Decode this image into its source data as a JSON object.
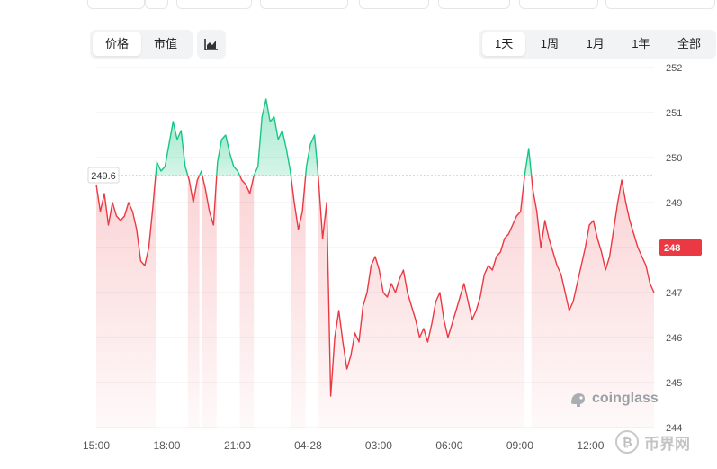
{
  "toolbar": {
    "metric_tabs": [
      {
        "label": "价格",
        "active": true
      },
      {
        "label": "市值",
        "active": false
      }
    ],
    "range_tabs": [
      {
        "label": "1天",
        "active": true
      },
      {
        "label": "1周",
        "active": false
      },
      {
        "label": "1月",
        "active": false
      },
      {
        "label": "1年",
        "active": false
      },
      {
        "label": "全部",
        "active": false
      }
    ],
    "chart_type_icon": "area-chart-icon"
  },
  "watermark": {
    "text": "coinglass",
    "icon": "coinglass-logo-icon"
  },
  "corner_logo": {
    "text": "币界网",
    "icon": "bitcoin-coin-icon"
  },
  "colors": {
    "up": "#16c784",
    "down": "#ea3943",
    "grid": "#ececec",
    "axis_text": "#555555"
  },
  "chart_data": {
    "type": "area",
    "baseline": 249.6,
    "baseline_label": "249.6",
    "last_value_label": "248",
    "x_ticks": [
      "15:00",
      "18:00",
      "21:00",
      "04-28",
      "03:00",
      "06:00",
      "09:00",
      "12:00"
    ],
    "y_ticks": [
      244,
      245,
      246,
      247,
      248,
      249,
      250,
      251,
      252
    ],
    "ylim": [
      244,
      252
    ],
    "xlim": [
      0,
      7.9
    ],
    "grid": true,
    "values": [
      249.4,
      248.8,
      249.2,
      248.5,
      249.0,
      248.7,
      248.6,
      248.7,
      249.0,
      248.8,
      248.4,
      247.7,
      247.6,
      248.0,
      248.9,
      249.9,
      249.7,
      249.8,
      250.3,
      250.8,
      250.4,
      250.6,
      249.8,
      249.5,
      249.0,
      249.5,
      249.7,
      249.3,
      248.8,
      248.5,
      249.9,
      250.4,
      250.5,
      250.1,
      249.8,
      249.7,
      249.5,
      249.4,
      249.2,
      249.6,
      249.8,
      250.9,
      251.3,
      250.8,
      250.9,
      250.4,
      250.6,
      250.2,
      249.7,
      249.0,
      248.4,
      248.8,
      249.8,
      250.3,
      250.5,
      249.5,
      248.2,
      249.0,
      244.7,
      246.0,
      246.6,
      245.9,
      245.3,
      245.6,
      246.1,
      245.9,
      246.7,
      247.0,
      247.6,
      247.8,
      247.5,
      247.0,
      246.9,
      247.2,
      247.0,
      247.3,
      247.5,
      247.0,
      246.7,
      246.4,
      246.0,
      246.2,
      245.9,
      246.3,
      246.8,
      247.0,
      246.4,
      246.0,
      246.3,
      246.6,
      246.9,
      247.2,
      246.8,
      246.4,
      246.6,
      246.9,
      247.4,
      247.6,
      247.5,
      247.8,
      247.9,
      248.2,
      248.3,
      248.5,
      248.7,
      248.8,
      249.6,
      250.2,
      249.3,
      248.8,
      248.0,
      248.6,
      248.2,
      247.9,
      247.6,
      247.4,
      247.0,
      246.6,
      246.8,
      247.2,
      247.6,
      248.0,
      248.5,
      248.6,
      248.2,
      247.9,
      247.5,
      247.8,
      248.4,
      249.0,
      249.5,
      249.0,
      248.6,
      248.3,
      248.0,
      247.8,
      247.6,
      247.2,
      247.0
    ]
  }
}
